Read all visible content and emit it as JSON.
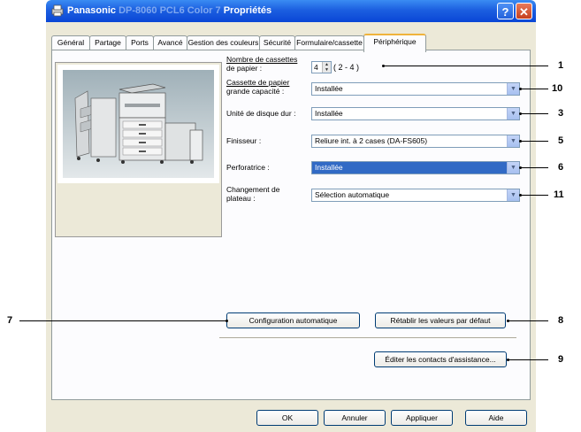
{
  "window": {
    "brand": "Panasonic",
    "blurred_model": "DP-8060 PCL6 Color 7",
    "title_suffix": "Propriétés"
  },
  "tabs": [
    "Général",
    "Partage",
    "Ports",
    "Avancé",
    "Gestion des couleurs",
    "Sécurité",
    "Formulaire/cassette",
    "Périphérique"
  ],
  "active_tab": "Périphérique",
  "fields": {
    "cassettes_label_1": "Nombre de cassettes",
    "cassettes_label_2": "de papier :",
    "cassettes_value": "4",
    "cassettes_range": "( 2 - 4 )",
    "lcc_label_1": "Cassette de papier",
    "lcc_label_2": "grande capacité :",
    "lcc_value": "Installée",
    "hdd_label": "Unité de disque dur :",
    "hdd_value": "Installée",
    "finisher_label": "Finisseur :",
    "finisher_value": "Reliure int. à 2 cases (DA-FS605)",
    "punch_label": "Perforatrice :",
    "punch_value": "Installée",
    "tray_label_1": "Changement de",
    "tray_label_2": "plateau :",
    "tray_value": "Sélection automatique"
  },
  "buttons": {
    "auto_config": "Configuration automatique",
    "restore_defaults": "Rétablir les valeurs par défaut",
    "support_contacts": "Éditer les contacts d'assistance...",
    "ok": "OK",
    "cancel": "Annuler",
    "apply": "Appliquer",
    "help": "Aide"
  },
  "callouts": [
    "1",
    "10",
    "3",
    "5",
    "6",
    "11",
    "7",
    "8",
    "9"
  ],
  "icons": [
    "printer-icon",
    "help-icon",
    "close-icon",
    "dropdown-arrow-icon",
    "spin-arrows-icon"
  ],
  "colors": {
    "titlebar": "#0a46d6",
    "window_bg": "#ece9d8",
    "tab_highlight": "#f0b33c",
    "selection": "#316ac5",
    "close_button": "#c5401f"
  }
}
